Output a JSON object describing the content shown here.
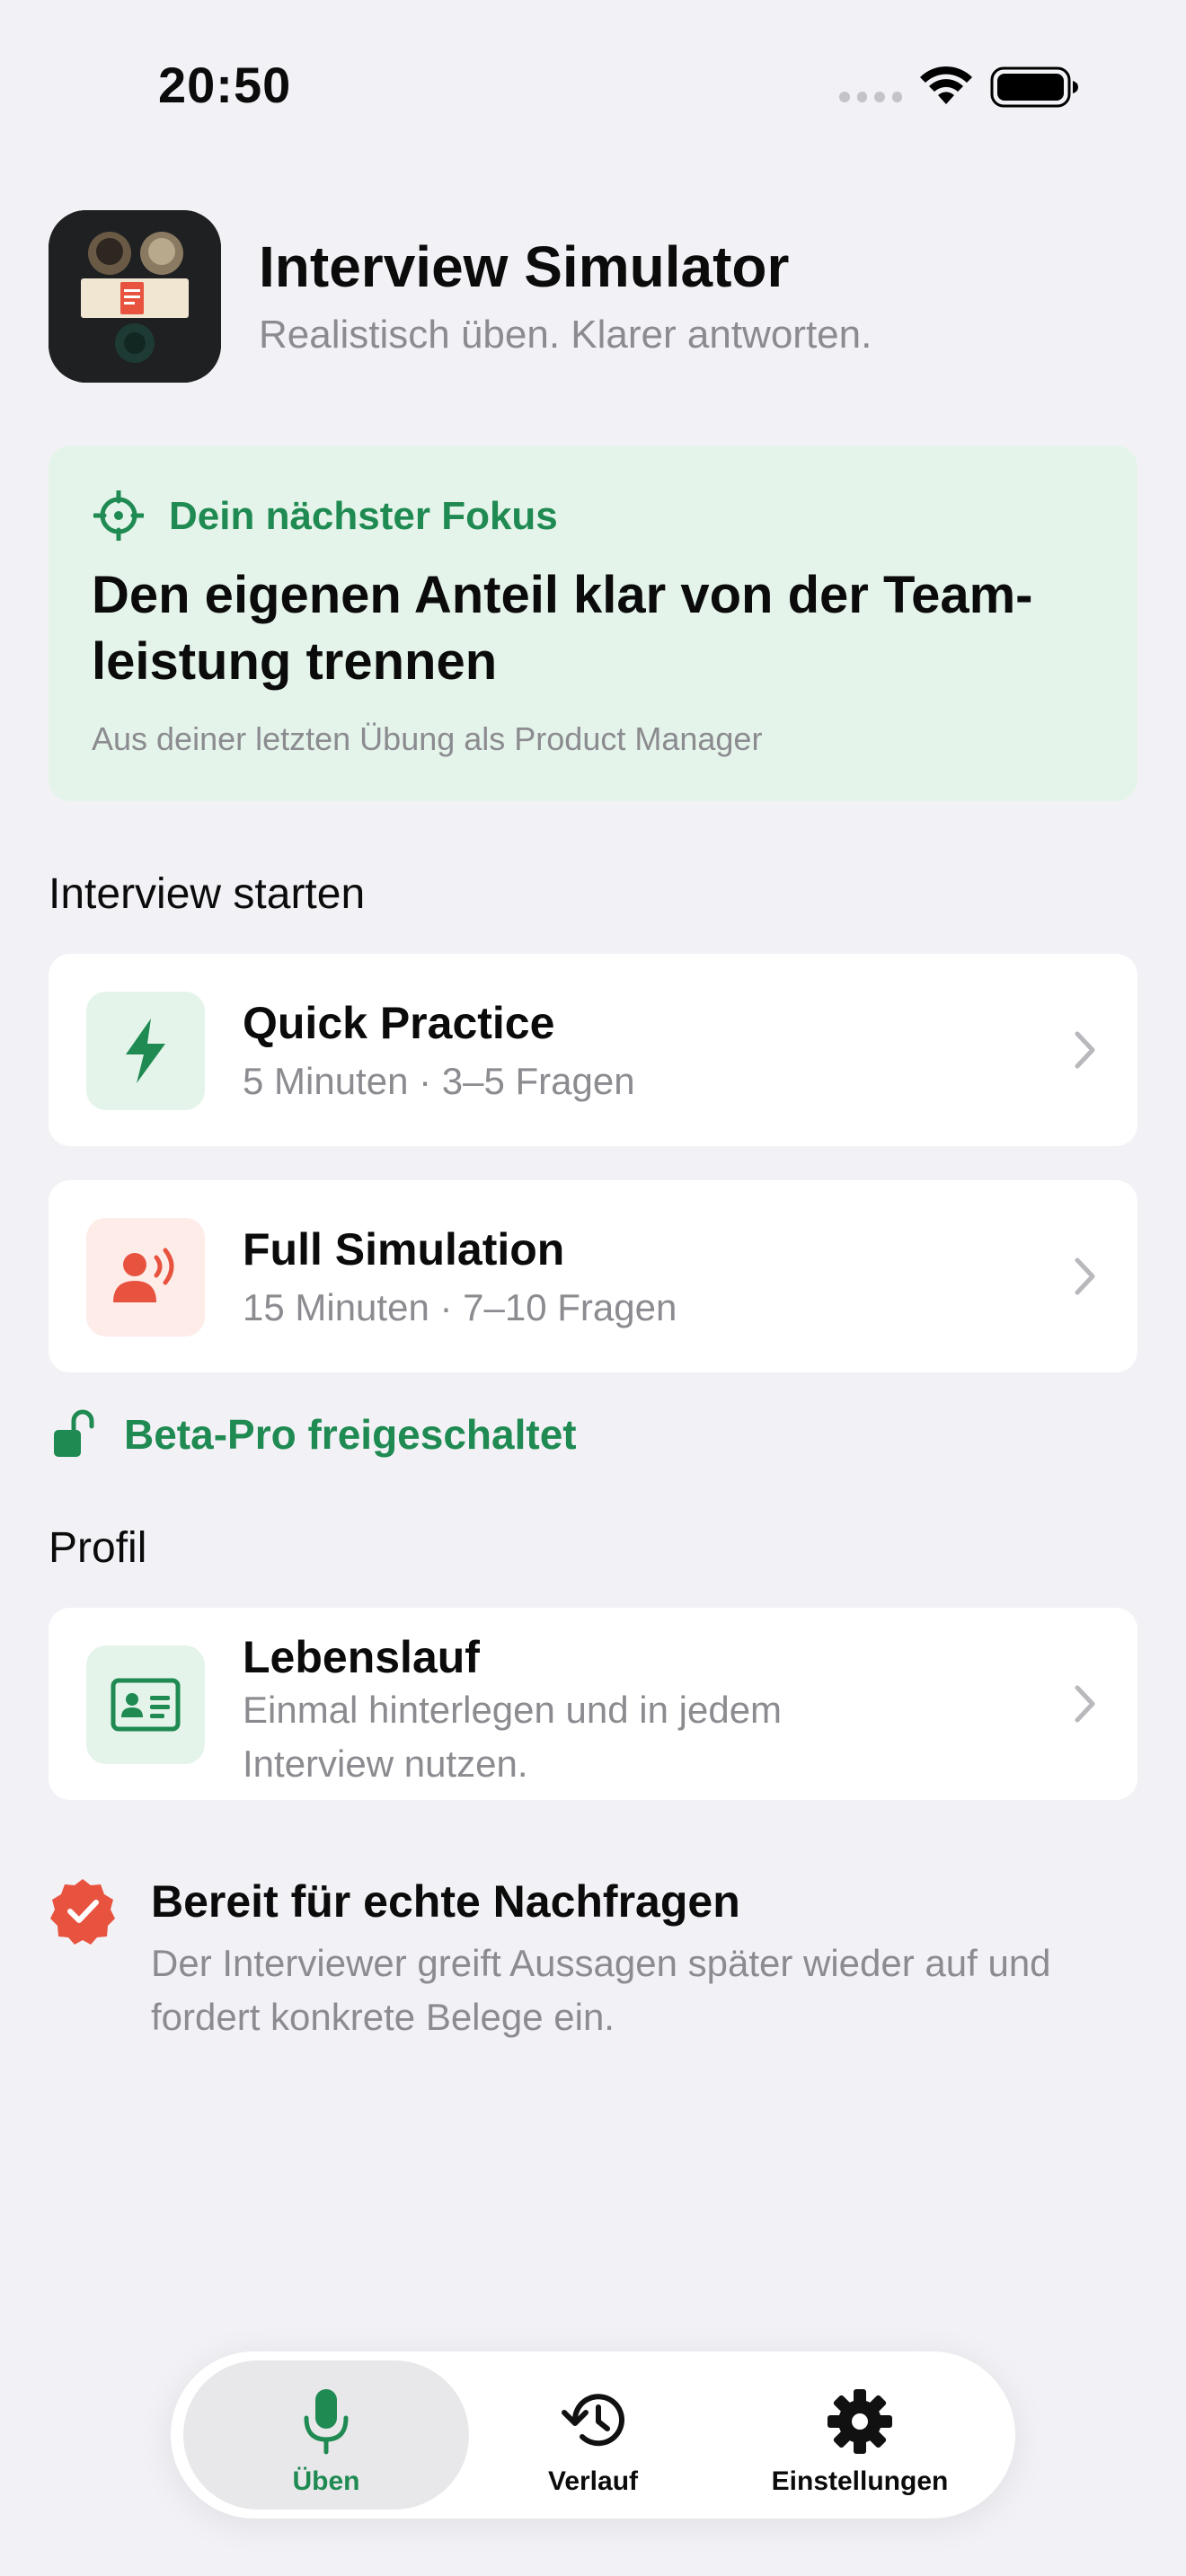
{
  "status_bar": {
    "time": "20:50"
  },
  "header": {
    "title": "Interview Simulator",
    "subtitle": "Realistisch üben. Klarer antworten."
  },
  "focus": {
    "label": "Dein nächster Fokus",
    "title": "Den eigenen Anteil klar von der Team-leistung trennen",
    "note": "Aus deiner letzten Übung als Product Manager"
  },
  "start_section": {
    "heading": "Interview starten",
    "items": [
      {
        "title": "Quick Practice",
        "subtitle": "5 Minuten · 3–5 Fragen",
        "icon": "bolt-icon"
      },
      {
        "title": "Full Simulation",
        "subtitle": "15 Minuten · 7–10 Fragen",
        "icon": "speaking-person-icon"
      }
    ],
    "beta_label": "Beta-Pro freigeschaltet"
  },
  "profile_section": {
    "heading": "Profil",
    "item": {
      "title": "Lebenslauf",
      "subtitle": "Einmal hinterlegen und in jedem Interview nutzen.",
      "icon": "id-card-icon"
    }
  },
  "ready": {
    "title": "Bereit für echte Nachfragen",
    "text": "Der Interviewer greift Aussagen später wieder auf und fordert konkrete Belege ein."
  },
  "tab_bar": {
    "tabs": [
      {
        "label": "Üben",
        "icon": "microphone-icon",
        "active": true
      },
      {
        "label": "Verlauf",
        "icon": "history-icon",
        "active": false
      },
      {
        "label": "Einstellungen",
        "icon": "gear-icon",
        "active": false
      }
    ]
  },
  "colors": {
    "accent_green": "#1f8a52",
    "focus_bg": "#e5f4ea",
    "accent_red": "#e8533f",
    "page_bg": "#f2f2f6"
  }
}
